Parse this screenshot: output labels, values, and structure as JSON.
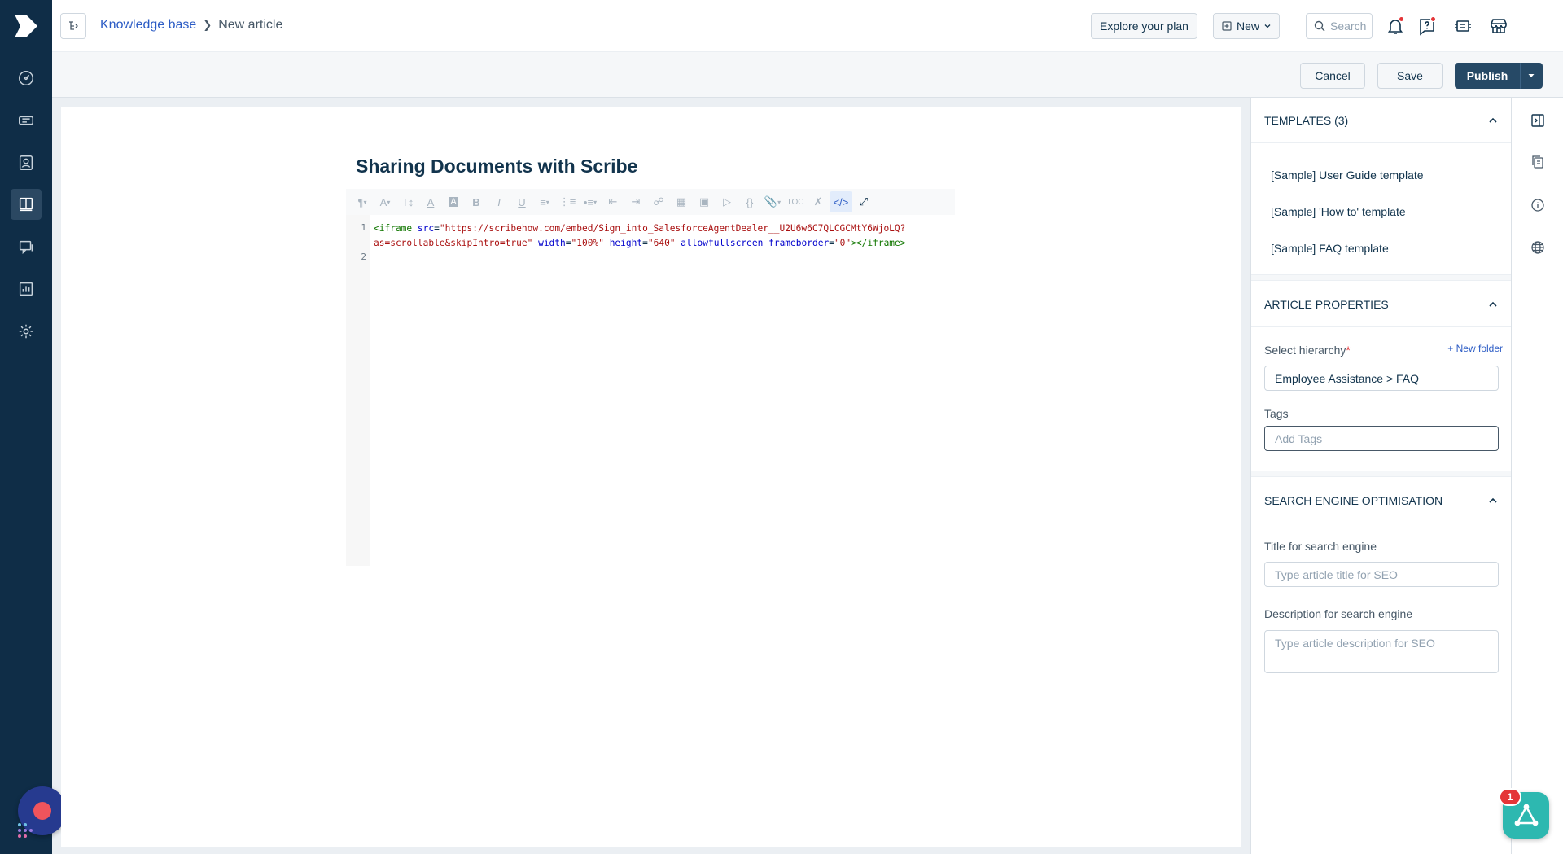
{
  "header": {
    "breadcrumb_root": "Knowledge base",
    "breadcrumb_current": "New article",
    "explore_label": "Explore your plan",
    "new_label": "New",
    "search_placeholder": "Search"
  },
  "actions": {
    "cancel": "Cancel",
    "save": "Save",
    "publish": "Publish"
  },
  "editor": {
    "title": "Sharing Documents with Scribe",
    "line_numbers": [
      "1",
      "2"
    ],
    "code": {
      "open": "<iframe",
      "src_attr": "src",
      "src_val_1": "\"https://scribehow.com/embed/Sign_into_SalesforceAgentDealer__U2U6w6C7QLCGCMtY6WjoLQ?",
      "src_val_2": "as=scrollable&skipIntro=true\"",
      "width_attr": "width",
      "width_val": "\"100%\"",
      "height_attr": "height",
      "height_val": "\"640\"",
      "allow_attr": "allowfullscreen",
      "frame_attr": "frameborder",
      "frame_val": "\"0\"",
      "close": "></iframe>"
    },
    "toolbar_text": {
      "toc": "TOC",
      "braces": "{}"
    }
  },
  "templates": {
    "header": "TEMPLATES (3)",
    "items": [
      "[Sample] User Guide template",
      "[Sample] 'How to' template",
      "[Sample] FAQ template"
    ]
  },
  "properties": {
    "header": "ARTICLE PROPERTIES",
    "hierarchy_label": "Select hierarchy",
    "required_mark": "*",
    "new_folder": "+ New folder",
    "hierarchy_value": "Employee Assistance > FAQ",
    "tags_label": "Tags",
    "tags_placeholder": "Add Tags"
  },
  "seo": {
    "header": "SEARCH ENGINE OPTIMISATION",
    "title_label": "Title for search engine",
    "title_placeholder": "Type article title for SEO",
    "desc_label": "Description for search engine",
    "desc_placeholder": "Type article description for SEO"
  },
  "widget": {
    "badge_count": "1"
  },
  "colors": {
    "nav_bg": "#0f2d47",
    "primary": "#264966",
    "link": "#2c5cc5",
    "widget": "#2db8b0",
    "record": "#f0545c"
  }
}
